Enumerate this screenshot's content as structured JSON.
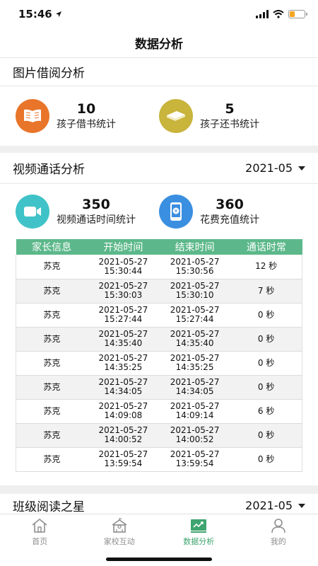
{
  "status_bar": {
    "time": "15:46"
  },
  "header": {
    "title": "数据分析"
  },
  "picture_section": {
    "title": "图片借阅分析",
    "stats": [
      {
        "value": "10",
        "label": "孩子借书统计",
        "icon": "open-book-icon",
        "color": "#e8752a"
      },
      {
        "value": "5",
        "label": "孩子还书统计",
        "icon": "closed-book-icon",
        "color": "#c9b43c"
      }
    ]
  },
  "video_section": {
    "title": "视频通话分析",
    "month": "2021-05",
    "stats": [
      {
        "value": "350",
        "label": "视频通话时间统计",
        "icon": "video-camera-icon",
        "color": "#3fc3c8"
      },
      {
        "value": "360",
        "label": "花费充值统计",
        "icon": "phone-yen-icon",
        "color": "#3a8fe0"
      }
    ],
    "table": {
      "headers": [
        "家长信息",
        "开始时间",
        "结束时间",
        "通话时常"
      ],
      "rows": [
        {
          "parent": "苏克",
          "start_date": "2021-05-27",
          "start_time": "15:30:44",
          "end_date": "2021-05-27",
          "end_time": "15:30:56",
          "duration": "12 秒"
        },
        {
          "parent": "苏克",
          "start_date": "2021-05-27",
          "start_time": "15:30:03",
          "end_date": "2021-05-27",
          "end_time": "15:30:10",
          "duration": "7 秒"
        },
        {
          "parent": "苏克",
          "start_date": "2021-05-27",
          "start_time": "15:27:44",
          "end_date": "2021-05-27",
          "end_time": "15:27:44",
          "duration": "0 秒"
        },
        {
          "parent": "苏克",
          "start_date": "2021-05-27",
          "start_time": "14:35:40",
          "end_date": "2021-05-27",
          "end_time": "14:35:40",
          "duration": "0 秒"
        },
        {
          "parent": "苏克",
          "start_date": "2021-05-27",
          "start_time": "14:35:25",
          "end_date": "2021-05-27",
          "end_time": "14:35:25",
          "duration": "0 秒"
        },
        {
          "parent": "苏克",
          "start_date": "2021-05-27",
          "start_time": "14:34:05",
          "end_date": "2021-05-27",
          "end_time": "14:34:05",
          "duration": "0 秒"
        },
        {
          "parent": "苏克",
          "start_date": "2021-05-27",
          "start_time": "14:09:08",
          "end_date": "2021-05-27",
          "end_time": "14:09:14",
          "duration": "6 秒"
        },
        {
          "parent": "苏克",
          "start_date": "2021-05-27",
          "start_time": "14:00:52",
          "end_date": "2021-05-27",
          "end_time": "14:00:52",
          "duration": "0 秒"
        },
        {
          "parent": "苏克",
          "start_date": "2021-05-27",
          "start_time": "13:59:54",
          "end_date": "2021-05-27",
          "end_time": "13:59:54",
          "duration": "0 秒"
        }
      ]
    }
  },
  "star_section": {
    "title": "班级阅读之星",
    "month": "2021-05"
  },
  "tab_bar": {
    "items": [
      {
        "label": "首页",
        "icon": "home-icon"
      },
      {
        "label": "家校互动",
        "icon": "school-icon"
      },
      {
        "label": "数据分析",
        "icon": "chart-board-icon",
        "active": true
      },
      {
        "label": "我的",
        "icon": "person-icon"
      }
    ],
    "active_color": "#3fa46f"
  }
}
